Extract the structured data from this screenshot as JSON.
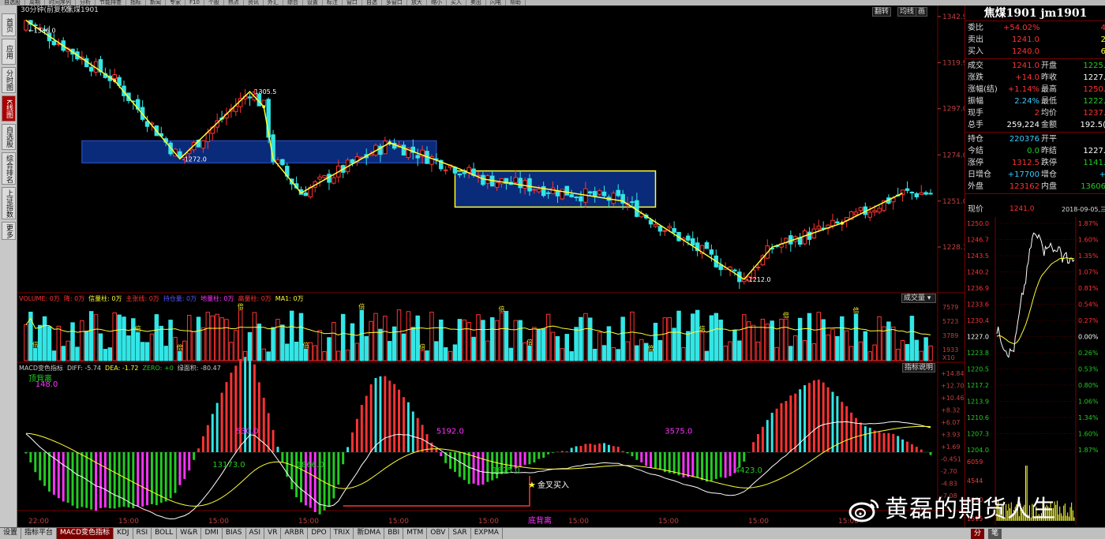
{
  "toolbar": [
    "自选股",
    "周期",
    "时间序列",
    "分析",
    "节能排查",
    "指标",
    "新闻",
    "专家",
    "F10",
    "个股",
    "热点",
    "资讯",
    "外汇",
    "综合",
    "设置",
    "标注",
    "窗口",
    "自选",
    "多窗口",
    "放大",
    "缩小",
    "买入",
    "卖出",
    "闪电",
    "帮助"
  ],
  "left_tabs": [
    "首页",
    "应用",
    "分时图",
    "K线图",
    "自选股",
    "综合排名",
    "上证指数",
    "更多"
  ],
  "left_active": 3,
  "chart": {
    "period_label": "30分钟(前复权)",
    "symbol": "焦煤1901",
    "top_buttons": [
      "翻转",
      "均线",
      "画"
    ],
    "price_axis": [
      {
        "p": 1342.9,
        "label": "1342.9"
      },
      {
        "p": 1319.9,
        "label": "1319.9"
      },
      {
        "p": 1297.0,
        "label": "1297.0"
      },
      {
        "p": 1274.0,
        "label": "1274.0"
      },
      {
        "p": 1251.0,
        "label": "1251.0"
      },
      {
        "p": 1228.1,
        "label": "1228.1"
      }
    ],
    "annotations": [
      {
        "label": "←1336.0",
        "bar": 0,
        "price": 1336.0
      },
      {
        "label": "-1305.5",
        "bar": 48,
        "price": 1305.5
      },
      {
        "label": "-1272.0",
        "bar": 33,
        "price": 1272.0
      },
      {
        "label": "-1212.0",
        "bar": 154,
        "price": 1212.0
      }
    ],
    "trend_points": [
      [
        0,
        1341
      ],
      [
        19,
        1311
      ],
      [
        33,
        1272
      ],
      [
        48,
        1305.5
      ],
      [
        51,
        1298
      ],
      [
        53,
        1272
      ],
      [
        59,
        1255
      ],
      [
        78,
        1280
      ],
      [
        93,
        1267
      ],
      [
        98,
        1262
      ],
      [
        128,
        1251
      ],
      [
        154,
        1212
      ],
      [
        160,
        1228
      ],
      [
        175,
        1240
      ],
      [
        188,
        1255
      ]
    ],
    "boxes": [
      {
        "b1": 12,
        "b2": 88,
        "p1": 1281,
        "p2": 1270,
        "fill": "#0a2a7a",
        "stroke": "#2244aa"
      },
      {
        "b1": 92,
        "b2": 135,
        "p1": 1266,
        "p2": 1248,
        "fill": "#0a2a7a",
        "stroke": "#ffff33"
      }
    ],
    "start_price": 1336,
    "last_price": 1241,
    "bar_count": 195
  },
  "volume": {
    "header": [
      "VOLUME: 0万",
      "降: 0万",
      "信量柱: 0万",
      "主张线: 0万",
      "持仓量: 0万",
      "地量柱: 0万",
      "高量柱: 0万",
      "MA1: 0万"
    ],
    "header_colors": [
      "#ff3333",
      "#ff3333",
      "#ffff33",
      "#ff3333",
      "#5555ff",
      "#ff33ff",
      "#ff3333",
      "#ffff33"
    ],
    "dropdown": "成交量",
    "axis": [
      "7579",
      "5723",
      "3789",
      "1933"
    ],
    "unit": "X10",
    "marker": "倍"
  },
  "macd": {
    "header": [
      "MACD变色指标",
      "DIFF: -5.74",
      "DEA: -1.72",
      "ZERO: +0",
      "绿面积: -80.47"
    ],
    "header_colors": [
      "#cccccc",
      "#cccccc",
      "#ffff33",
      "#22cc22",
      "#cccccc"
    ],
    "button": "指标说明",
    "divergence_top": "顶背离",
    "divergence_bottom": "底背离",
    "golden_cross": "金叉买入",
    "areas": [
      {
        "label": "148.0",
        "bar": 2,
        "color": "#ff33ff",
        "y": 0.1
      },
      {
        "label": "530.0",
        "bar": 45,
        "color": "#ff33ff",
        "y": 0.45
      },
      {
        "label": "5192.0",
        "bar": 88,
        "color": "#ff33ff",
        "y": 0.45
      },
      {
        "label": "3575.0",
        "bar": 137,
        "color": "#ff33ff",
        "y": 0.45
      },
      {
        "label": "13173.0",
        "bar": 40,
        "color": "#22cc22",
        "y": 0.7
      },
      {
        "label": "1866.0",
        "bar": 58,
        "color": "#22cc22",
        "y": 0.7
      },
      {
        "label": "1825.0",
        "bar": 100,
        "color": "#22cc22",
        "y": 0.74
      },
      {
        "label": "4423.0",
        "bar": 152,
        "color": "#22cc22",
        "y": 0.74
      }
    ],
    "axis": [
      "+14.84",
      "+12.70",
      "+10.46",
      "+8.32",
      "+6.07",
      "+3.93",
      "+1.69",
      "-0.451",
      "-2.70",
      "-4.83",
      "-7.08"
    ]
  },
  "time_axis": [
    "22:00",
    "15:00",
    "15:00",
    "15:00",
    "15:00",
    "15:00",
    "15:00",
    "15:00",
    "15:00",
    "15:00"
  ],
  "bottom_tabs": [
    "设置",
    "指标平台",
    "MACD变色指标",
    "KDJ",
    "RSI",
    "BOLL",
    "W&R",
    "DMI",
    "BIAS",
    "ASI",
    "VR",
    "ARBR",
    "DPO",
    "TRIX",
    "新DMA",
    "BBI",
    "MTM",
    "OBV",
    "SAR",
    "EXPMA"
  ],
  "bottom_active": 2,
  "bottom_right_tabs": [
    "分",
    "笔"
  ],
  "watermark": "黄磊的期货人生",
  "quote": {
    "title": "焦煤1901 jm1901",
    "rows1": [
      {
        "k": "委比",
        "v": "+54.02%",
        "vc": "#ff3333",
        "k2": "",
        "v2": "4",
        "v2c": "#ff3333"
      },
      {
        "k": "卖出",
        "v": "1241.0",
        "vc": "#ff3333",
        "k2": "",
        "v2": "2",
        "v2c": "#ffff33"
      },
      {
        "k": "买入",
        "v": "1240.0",
        "vc": "#ff3333",
        "k2": "",
        "v2": "6",
        "v2c": "#ffff33"
      }
    ],
    "rows2": [
      {
        "k": "成交",
        "v": "1241.0",
        "vc": "#ff3333",
        "k2": "开盘",
        "v2": "1225.",
        "v2c": "#22cc22"
      },
      {
        "k": "涨跌",
        "v": "+14.0",
        "vc": "#ff3333",
        "k2": "昨收",
        "v2": "1227.",
        "v2c": "#ffffff"
      },
      {
        "k": "涨幅(结)",
        "v": "+1.14%",
        "vc": "#ff3333",
        "k2": "最高",
        "v2": "1250.",
        "v2c": "#ff3333"
      },
      {
        "k": "振幅",
        "v": "2.24%",
        "vc": "#33ccff",
        "k2": "最低",
        "v2": "1222.",
        "v2c": "#22cc22"
      },
      {
        "k": "现手",
        "v": "2",
        "vc": "#ff3333",
        "k2": "均价",
        "v2": "1237.",
        "v2c": "#ff3333"
      },
      {
        "k": "总手",
        "v": "259,224",
        "vc": "#ffffff",
        "k2": "金额",
        "v2": "192.5(",
        "v2c": "#ffffff"
      }
    ],
    "rows3": [
      {
        "k": "持仓",
        "v": "220376",
        "vc": "#33ccff",
        "k2": "开平",
        "v2": "",
        "v2c": "#ffffff"
      },
      {
        "k": "今结",
        "v": "0.0",
        "vc": "#22cc22",
        "k2": "昨结",
        "v2": "1227.",
        "v2c": "#ffffff"
      },
      {
        "k": "涨停",
        "v": "1312.5",
        "vc": "#ff3333",
        "k2": "跌停",
        "v2": "1141.",
        "v2c": "#22cc22"
      },
      {
        "k": "日增仓",
        "v": "+17700",
        "vc": "#33ccff",
        "k2": "增仓",
        "v2": "+",
        "v2c": "#33ccff"
      },
      {
        "k": "外盘",
        "v": "123162",
        "vc": "#ff3333",
        "k2": "内盘",
        "v2": "13606",
        "v2c": "#22cc22"
      }
    ],
    "now_label": "现价",
    "now_value": "1241.0",
    "now_date": "2018-09-05,三",
    "mini_left": [
      "1250.0",
      "1246.7",
      "1243.5",
      "1240.2",
      "1236.9",
      "1233.6",
      "1230.4",
      "1227.0",
      "1223.8",
      "1220.5",
      "1217.2",
      "1213.9",
      "1210.6",
      "1207.3",
      "1204.0"
    ],
    "mini_right": [
      "1.87%",
      "1.60%",
      "1.35%",
      "1.07%",
      "0.81%",
      "0.54%",
      "0.27%",
      "0.00%",
      "0.26%",
      "0.53%",
      "0.80%",
      "1.06%",
      "1.34%",
      "1.60%",
      "1.87%"
    ],
    "mini_vol": [
      "6059",
      "4544",
      "3030",
      "1515"
    ]
  }
}
